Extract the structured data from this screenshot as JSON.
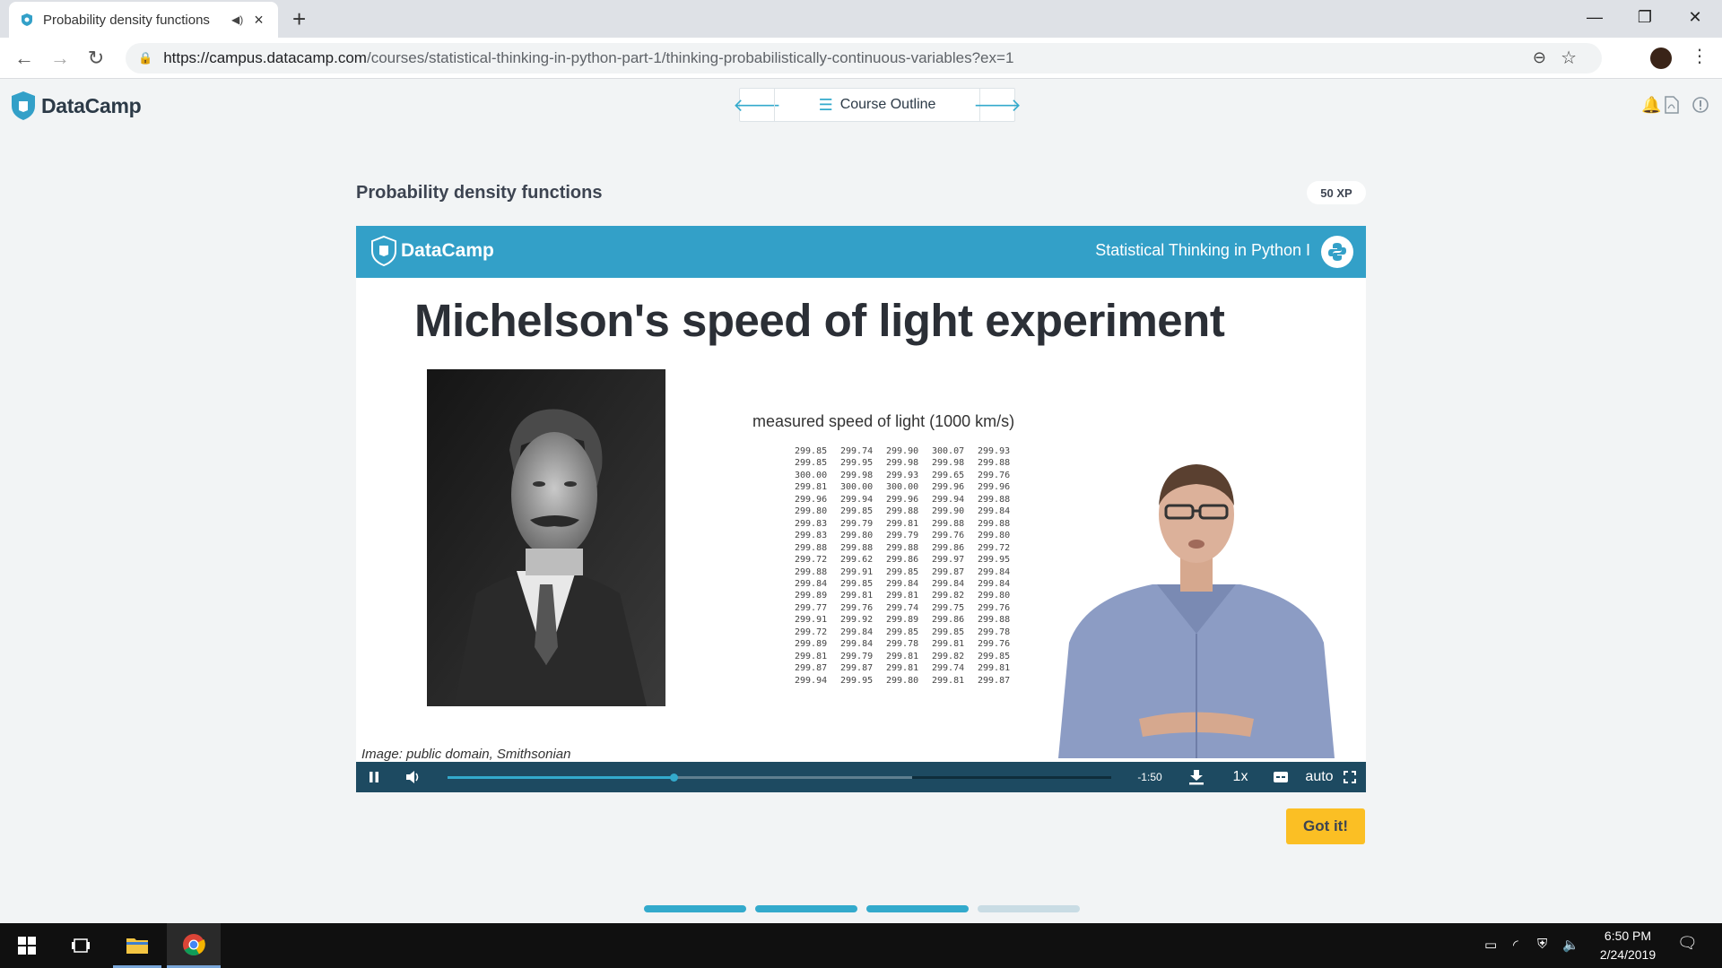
{
  "browser": {
    "tab_title": "Probability density functions",
    "new_tab_icon": "plus-icon",
    "url_host": "https://campus.datacamp.com",
    "url_path": "/courses/statistical-thinking-in-python-part-1/thinking-probabilistically-continuous-variables?ex=1",
    "window_controls": [
      "minimize",
      "restore",
      "close"
    ]
  },
  "header": {
    "logo_text": "DataCamp",
    "outline_label": "Course Outline",
    "prev_icon": "arrow-left-icon",
    "next_icon": "arrow-right-icon",
    "right_icons": [
      "bell-icon",
      "pdf-icon",
      "info-icon"
    ]
  },
  "exercise": {
    "title": "Probability density functions",
    "xp": "50 XP",
    "got_it_label": "Got it!"
  },
  "video": {
    "brand": "DataCamp",
    "course": "Statistical Thinking in Python I",
    "slide_title": "Michelson's speed of light experiment",
    "table_label": "measured speed of light (1000 km/s)",
    "credit": "Image: public domain, Smithsonian",
    "speed_table": [
      [
        "299.85",
        "299.74",
        "299.90",
        "300.07",
        "299.93"
      ],
      [
        "299.85",
        "299.95",
        "299.98",
        "299.98",
        "299.88"
      ],
      [
        "300.00",
        "299.98",
        "299.93",
        "299.65",
        "299.76"
      ],
      [
        "299.81",
        "300.00",
        "300.00",
        "299.96",
        "299.96"
      ],
      [
        "299.96",
        "299.94",
        "299.96",
        "299.94",
        "299.88"
      ],
      [
        "299.80",
        "299.85",
        "299.88",
        "299.90",
        "299.84"
      ],
      [
        "299.83",
        "299.79",
        "299.81",
        "299.88",
        "299.88"
      ],
      [
        "299.83",
        "299.80",
        "299.79",
        "299.76",
        "299.80"
      ],
      [
        "299.88",
        "299.88",
        "299.88",
        "299.86",
        "299.72"
      ],
      [
        "299.72",
        "299.62",
        "299.86",
        "299.97",
        "299.95"
      ],
      [
        "299.88",
        "299.91",
        "299.85",
        "299.87",
        "299.84"
      ],
      [
        "299.84",
        "299.85",
        "299.84",
        "299.84",
        "299.84"
      ],
      [
        "299.89",
        "299.81",
        "299.81",
        "299.82",
        "299.80"
      ],
      [
        "299.77",
        "299.76",
        "299.74",
        "299.75",
        "299.76"
      ],
      [
        "299.91",
        "299.92",
        "299.89",
        "299.86",
        "299.88"
      ],
      [
        "299.72",
        "299.84",
        "299.85",
        "299.85",
        "299.78"
      ],
      [
        "299.89",
        "299.84",
        "299.78",
        "299.81",
        "299.76"
      ],
      [
        "299.81",
        "299.79",
        "299.81",
        "299.82",
        "299.85"
      ],
      [
        "299.87",
        "299.87",
        "299.81",
        "299.74",
        "299.81"
      ],
      [
        "299.94",
        "299.95",
        "299.80",
        "299.81",
        "299.87"
      ]
    ],
    "controls": {
      "time_remaining": "-1:50",
      "speed": "1x",
      "quality": "auto",
      "played_fraction": 0.34,
      "buffered_fraction": 0.7
    }
  },
  "lesson_progress": {
    "segments": 4,
    "completed": 3,
    "done_color": "#33aacc",
    "todo_color": "#c9dce4"
  },
  "taskbar": {
    "time": "6:50 PM",
    "date": "2/24/2019",
    "pinned": [
      "windows-start-icon",
      "task-view-icon",
      "file-explorer-icon",
      "chrome-icon"
    ]
  },
  "colors": {
    "brand_blue": "#33a0c8",
    "player_bar": "#1d4a61",
    "got_it": "#fbbf24"
  }
}
